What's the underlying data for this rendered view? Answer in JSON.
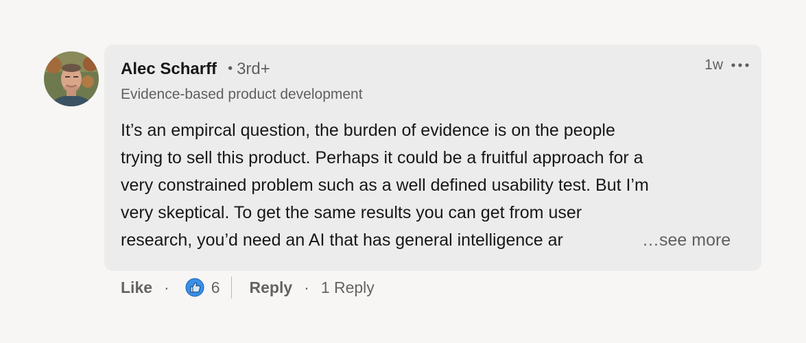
{
  "comment": {
    "author_name": "Alec Scharff",
    "degree_separator": "•",
    "connection_degree": "3rd+",
    "headline": "Evidence-based product development",
    "timestamp": "1w",
    "more_icon": "ellipsis-icon",
    "body_lines": [
      "It’s an empircal question, the burden of evidence is on the people",
      "trying to sell this product. Perhaps it could be a fruitful approach for a",
      "very constrained problem such as a well defined usability test. But I’m",
      "very skeptical. To get the same results you can get from user",
      "research, you’d need an AI that has general intelligence ar"
    ],
    "see_more_label": "…see more"
  },
  "actions": {
    "like_label": "Like",
    "dot": "·",
    "reaction_icon": "like-thumb-icon",
    "reaction_count": "6",
    "reply_label": "Reply",
    "reply_count_label": "1 Reply"
  },
  "colors": {
    "bubble_bg": "#ececec",
    "page_bg": "#f7f6f5",
    "like_blue": "#378fe9"
  }
}
